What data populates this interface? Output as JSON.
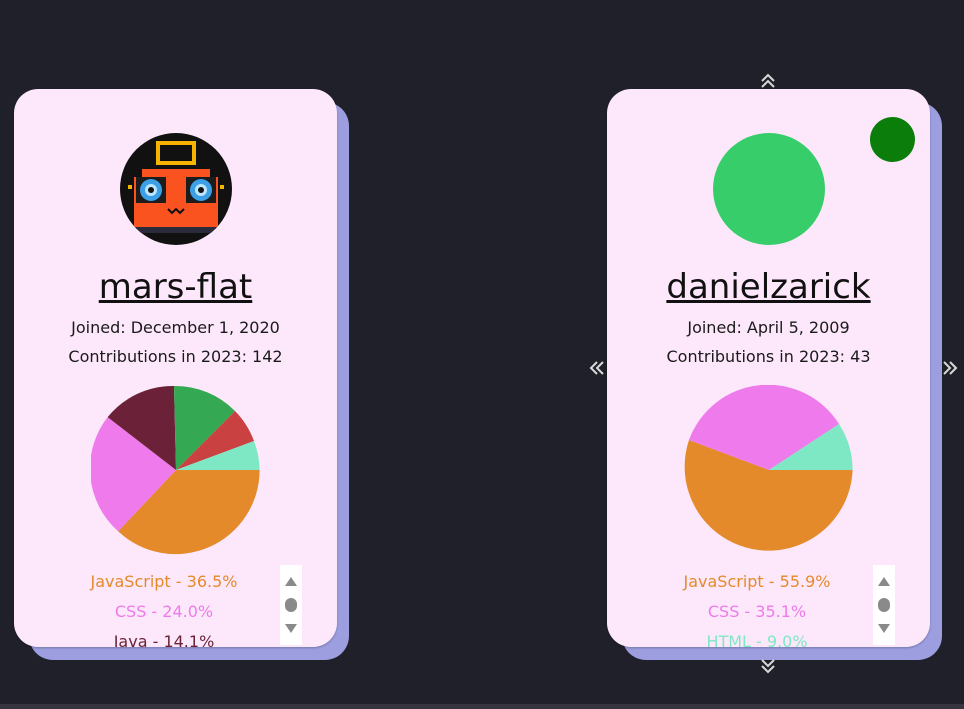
{
  "cards": [
    {
      "username": "mars-flat",
      "joined": "Joined: December 1, 2020",
      "contributions": "Contributions in 2023: 142",
      "languages": [
        {
          "label": "JavaScript - 36.5%",
          "color": "#e48a2b"
        },
        {
          "label": "CSS - 24.0%",
          "color": "#ee7aeb"
        },
        {
          "label": "Java - 14.1%",
          "color": "#6b2238"
        }
      ],
      "pie_colors": [
        "#e48a2b",
        "#ee7aeb",
        "#6b2238",
        "#34a853",
        "#c94141",
        "#7ee8c5"
      ]
    },
    {
      "username": "danielzarick",
      "joined": "Joined: April 5, 2009",
      "contributions": "Contributions in 2023: 43",
      "languages": [
        {
          "label": "JavaScript - 55.9%",
          "color": "#e48a2b"
        },
        {
          "label": "CSS - 35.1%",
          "color": "#ee7aeb"
        },
        {
          "label": "HTML - 9.0%",
          "color": "#7ee8c5"
        }
      ],
      "status_color": "#0a7d0a"
    }
  ],
  "nav": {
    "up_icon": "double-chevron-up-icon",
    "down_icon": "double-chevron-down-icon",
    "left_icon": "double-chevron-left-icon",
    "right_icon": "double-chevron-right-icon"
  }
}
